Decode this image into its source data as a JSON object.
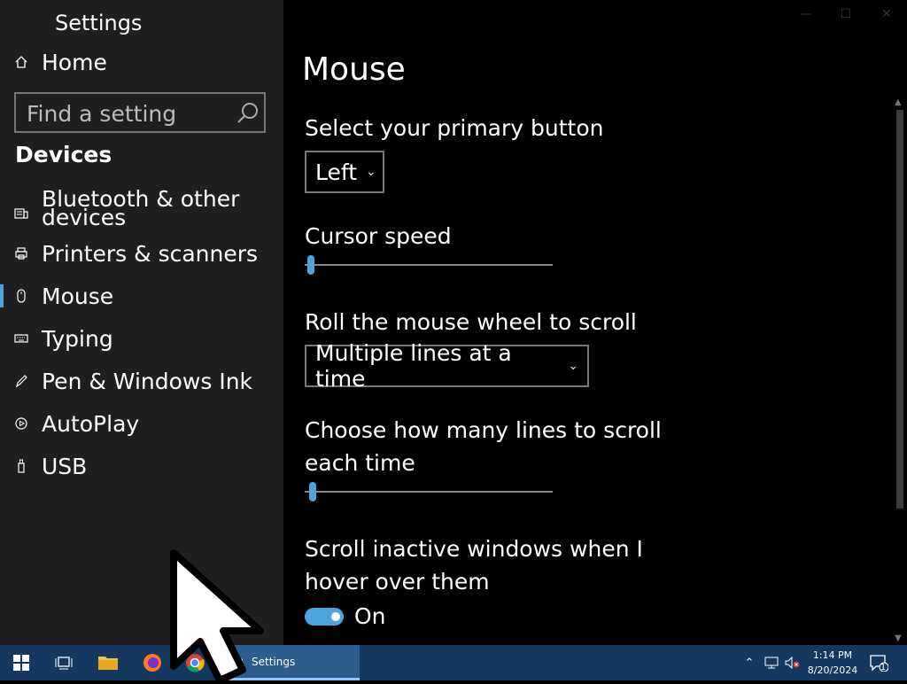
{
  "window": {
    "title": "Settings"
  },
  "sidebar": {
    "home_label": "Home",
    "search_placeholder": "Find a setting",
    "section_title": "Devices",
    "items": [
      {
        "label": "Bluetooth & other devices",
        "icon": "bluetooth-devices-icon"
      },
      {
        "label": "Printers & scanners",
        "icon": "printer-icon"
      },
      {
        "label": "Mouse",
        "icon": "mouse-icon",
        "active": true
      },
      {
        "label": "Typing",
        "icon": "keyboard-icon"
      },
      {
        "label": "Pen & Windows Ink",
        "icon": "pen-icon"
      },
      {
        "label": "AutoPlay",
        "icon": "autoplay-icon"
      },
      {
        "label": "USB",
        "icon": "usb-icon"
      }
    ]
  },
  "main": {
    "page_title": "Mouse",
    "primary_button": {
      "label": "Select your primary button",
      "value": "Left"
    },
    "cursor_speed": {
      "label": "Cursor speed",
      "level": 0.01
    },
    "wheel_scroll": {
      "label": "Roll the mouse wheel to scroll",
      "value": "Multiple lines at a time"
    },
    "lines_to_scroll": {
      "label_line1": "Choose how many lines to scroll",
      "label_line2": "each time",
      "level": 0.02
    },
    "inactive_scroll": {
      "label_line1": "Scroll inactive windows when I",
      "label_line2": "hover over them",
      "state": "On"
    }
  },
  "taskbar": {
    "active_app_label": "Settings",
    "time": "1:14 PM",
    "date": "8/20/2024",
    "notification_count": "1"
  },
  "colors": {
    "accent": "#4aa6dd",
    "sidebar_bg": "#1f1f1f",
    "taskbar_bg": "#14385f"
  }
}
